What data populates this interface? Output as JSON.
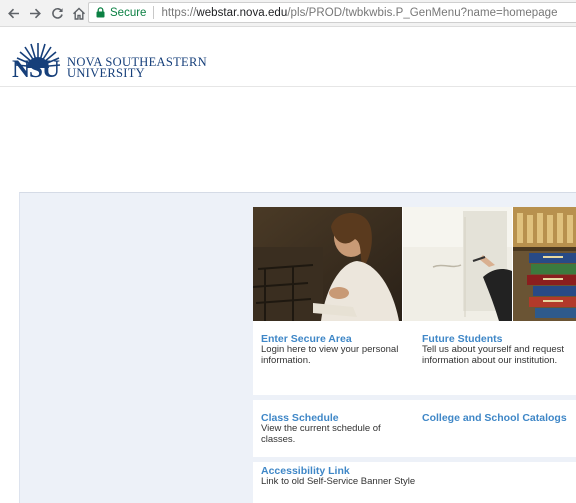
{
  "browser": {
    "back_icon": "arrow-left-icon",
    "forward_icon": "arrow-right-icon",
    "reload_icon": "reload-icon",
    "home_icon": "home-icon",
    "secure_label": "Secure",
    "url_scheme": "https://",
    "url_host": "webstar.nova.edu",
    "url_path": "/pls/PROD/twbkwbis.P_GenMenu?name=homepage",
    "secure_color": "#0b8043"
  },
  "header": {
    "logo_abbrev": "NSU",
    "logo_name_line1": "NOVA SOUTHEASTERN",
    "logo_name_line2": "UNIVERSITY",
    "brand_color": "#163f7a"
  },
  "tiles": [
    {
      "title": "Enter Secure Area",
      "description": "Login here to view your personal information."
    },
    {
      "title": "Future Students",
      "description": "Tell us about yourself and request information about our institution."
    },
    {
      "title": "Class Schedule",
      "description": "View the current schedule of classes."
    },
    {
      "title": "College and School Catalogs",
      "description": ""
    },
    {
      "title": "Accessibility Link",
      "description": "Link to old Self-Service Banner Style"
    }
  ],
  "colors": {
    "link": "#3f87c7",
    "panel_background": "#edf1f8"
  }
}
